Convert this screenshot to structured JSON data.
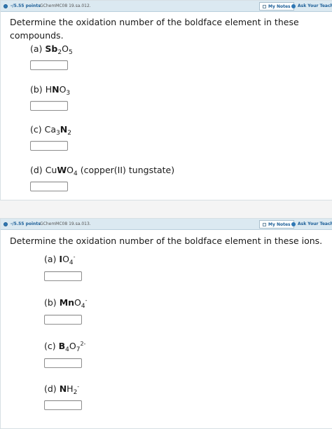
{
  "q1": {
    "points": "-/5.55 points",
    "id": "GChemMC08 19.sa.012.",
    "my_notes": "My Notes",
    "ask": "Ask Your Teache",
    "prompt": "Determine the oxidation number of the boldface element in these compounds.",
    "parts": [
      {
        "label": "(a)",
        "formula": "Sb2O5"
      },
      {
        "label": "(b)",
        "formula": "HNO3"
      },
      {
        "label": "(c)",
        "formula": "Ca3N2"
      },
      {
        "label": "(d)",
        "formula": "CuWO4",
        "note": "(copper(II) tungstate)"
      }
    ]
  },
  "q2": {
    "points": "-/5.55 points",
    "id": "GChemMC08 19.sa.013.",
    "my_notes": "My Notes",
    "ask": "Ask Your Teache",
    "prompt": "Determine the oxidation number of the boldface element in these ions.",
    "parts": [
      {
        "label": "(a)",
        "formula": "IO4-"
      },
      {
        "label": "(b)",
        "formula": "MnO4-"
      },
      {
        "label": "(c)",
        "formula": "B4O72-"
      },
      {
        "label": "(d)",
        "formula": "NH2-"
      }
    ]
  },
  "formula_text": {
    "q1a": {
      "bold": "Sb",
      "sub1": "2",
      "rest": "O",
      "sub2": "5"
    },
    "q1b": {
      "pre": "H",
      "bold": "N",
      "rest": "O",
      "sub": "3"
    },
    "q1c": {
      "pre": "Ca",
      "sub": "3",
      "bold": "N",
      "sub2": "2"
    },
    "q1d": {
      "pre": "Cu",
      "bold": "W",
      "rest": "O",
      "sub": "4"
    },
    "q2a": {
      "bold": "I",
      "rest": "O",
      "sub": "4",
      "sup": "-"
    },
    "q2b": {
      "bold": "Mn",
      "rest": "O",
      "sub": "4",
      "sup": "-"
    },
    "q2c": {
      "bold": "B",
      "sub1": "4",
      "rest": "O",
      "sub2": "7",
      "sup": "2-"
    },
    "q2d": {
      "bold": "N",
      "rest": "H",
      "sub": "2",
      "sup": "-"
    }
  }
}
